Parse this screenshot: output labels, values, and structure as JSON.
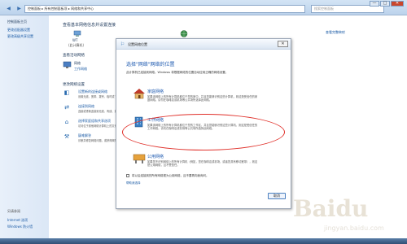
{
  "window": {
    "address": "控制面板 ▸ 所有控制面板项 ▸ 网络和共享中心",
    "search_placeholder": "搜索控制面板",
    "buttons": [
      "—",
      "□",
      "✕"
    ]
  },
  "leftpane": {
    "items": [
      "控制面板主页",
      "更改适配器设置",
      "更改高级共享设置"
    ],
    "see_also_header": "另请参阅",
    "see_also": [
      "Internet 选项",
      "Windows 防火墙"
    ]
  },
  "main": {
    "title": "查看基本网络信息并设置连接",
    "computer_label": "WT",
    "computer_sub": "(此计算机)",
    "right_link": "查看完整映射",
    "active_header": "查看活动网络",
    "network_name": "网络",
    "network_type": "工作网络",
    "change_header": "更改网络设置",
    "settings": [
      {
        "title": "设置新的连接或网络",
        "desc": "设置无线、宽带、拨号、临时或 VPN 连接；或设置路由器或访问点。"
      },
      {
        "title": "连接到网络",
        "desc": "连接或重新连接到无线、有线、拨号或 VPN 网络连接。"
      },
      {
        "title": "选择家庭组和共享选项",
        "desc": "访问位于其他网络计算机上的文件和打印机，或更改共享设置。"
      },
      {
        "title": "疑难解答",
        "desc": "诊断并修复网络问题，或获得故障排除信息。"
      }
    ]
  },
  "dialog": {
    "title": "设置网络位置",
    "close": "✕",
    "heading": "选择\"网络\"网络的位置",
    "intro": "此计算机已连接到网络。Windows 将根据网络的位置自动应用正确的网络设置。",
    "options": [
      {
        "title": "家庭网络",
        "desc": "如果该网络上的所有计算机都位于您的家中，并且您能够识别这些计算机，则这是受信任的家庭网络。请勿在咖啡店或机场等公共场所选择此网络。"
      },
      {
        "title": "工作网络",
        "desc": "如果该网络上的所有计算机都位于您的工作区，并且您能够识别这些计算机，则这是受信任的工作网络。请勿在咖啡店或机场等公共场所选择此网络。"
      },
      {
        "title": "公用网络",
        "desc": "如果您不识别网络上的所有计算机（例如，您在咖啡店或机场，或者您具有移动宽带），则这是公用网络，且不受信任。"
      }
    ],
    "checkbox_label": "将以后连接到的所有网络视为公用网络，且不要再向我询问。",
    "help_link": "帮助我选择",
    "ok": "取消"
  },
  "watermark": {
    "text": "Baidu",
    "sub": "jingyan.baidu.com"
  },
  "colors": {
    "accent": "#1e5ab0",
    "highlight": "#e0302a"
  }
}
